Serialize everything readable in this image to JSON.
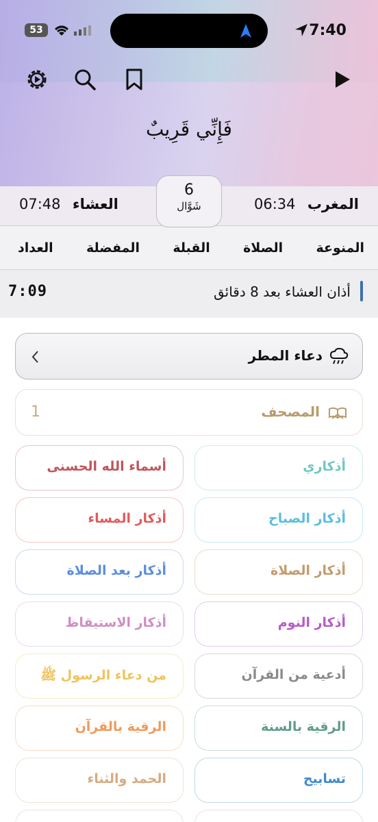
{
  "status": {
    "time": "7:40",
    "battery": "53"
  },
  "verse": "فَإِنِّي قَرِيبٌ",
  "prayers": {
    "maghrib": {
      "name": "المغرب",
      "time": "06:34"
    },
    "isha": {
      "name": "العشاء",
      "time": "07:48"
    }
  },
  "date": {
    "day": "6",
    "month": "شَوَّال"
  },
  "tabs": [
    "المنوعة",
    "الصلاة",
    "القبلة",
    "المفضلة",
    "العداد"
  ],
  "adhan": {
    "text": "أذان العشاء بعد 8 دقائق",
    "countdown": "7:09"
  },
  "rain": {
    "label": "دعاء المطر"
  },
  "mushaf": {
    "label": "المصحف",
    "count": "1"
  },
  "cards": [
    {
      "label": "أذكاري",
      "color": "#6ec8c0"
    },
    {
      "label": "أسماء الله الحسنى",
      "color": "#c0555b"
    },
    {
      "label": "أذكار الصباح",
      "color": "#5bbde0"
    },
    {
      "label": "أذكار المساء",
      "color": "#e25a5a"
    },
    {
      "label": "أذكار الصلاة",
      "color": "#c49a6c"
    },
    {
      "label": "أذكار بعد الصلاة",
      "color": "#5b8de0"
    },
    {
      "label": "أذكار النوم",
      "color": "#b65cc8"
    },
    {
      "label": "أذكار الاستيقاظ",
      "color": "#cf8ec4"
    },
    {
      "label": "أدعية من القرآن",
      "color": "#8a8a8a"
    },
    {
      "label": "من دعاء الرسول ﷺ",
      "color": "#eec45c"
    },
    {
      "label": "الرقية بالسنة",
      "color": "#5f9c8c"
    },
    {
      "label": "الرقية بالقرآن",
      "color": "#f09a5c"
    },
    {
      "label": "تسابيح",
      "color": "#3d8bd0"
    },
    {
      "label": "الحمد والثناء",
      "color": "#d8aa80"
    }
  ]
}
